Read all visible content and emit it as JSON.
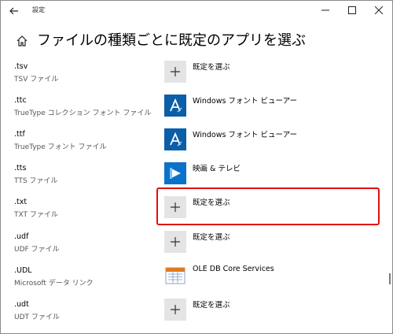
{
  "window": {
    "title": "設定",
    "controls": [
      "minimize",
      "maximize",
      "close"
    ]
  },
  "header": {
    "title": "ファイルの種類ごとに既定のアプリを選ぶ"
  },
  "rows": [
    {
      "ext": ".tsv",
      "desc": "TSV ファイル",
      "app": "既定を選ぶ",
      "icon": "plus-icon"
    },
    {
      "ext": ".ttc",
      "desc": "TrueType コレクション フォント ファイル",
      "app": "Windows フォント ビューアー",
      "icon": "font-viewer-icon"
    },
    {
      "ext": ".ttf",
      "desc": "TrueType フォント ファイル",
      "app": "Windows フォント ビューアー",
      "icon": "font-viewer-icon"
    },
    {
      "ext": ".tts",
      "desc": "TTS ファイル",
      "app": "映画 & テレビ",
      "icon": "movies-tv-icon"
    },
    {
      "ext": ".txt",
      "desc": "TXT ファイル",
      "app": "既定を選ぶ",
      "icon": "plus-icon"
    },
    {
      "ext": ".udf",
      "desc": "UDF ファイル",
      "app": "既定を選ぶ",
      "icon": "plus-icon"
    },
    {
      "ext": ".UDL",
      "desc": "Microsoft データ リンク",
      "app": "OLE DB Core Services",
      "icon": "ole-db-icon"
    },
    {
      "ext": ".udt",
      "desc": "UDT ファイル",
      "app": "既定を選ぶ",
      "icon": "plus-icon"
    }
  ],
  "highlighted_row": ".txt",
  "colors": {
    "highlight": "#e01010",
    "tile_gray": "#e4e4e4",
    "tile_blue": "#0b5ea8"
  }
}
